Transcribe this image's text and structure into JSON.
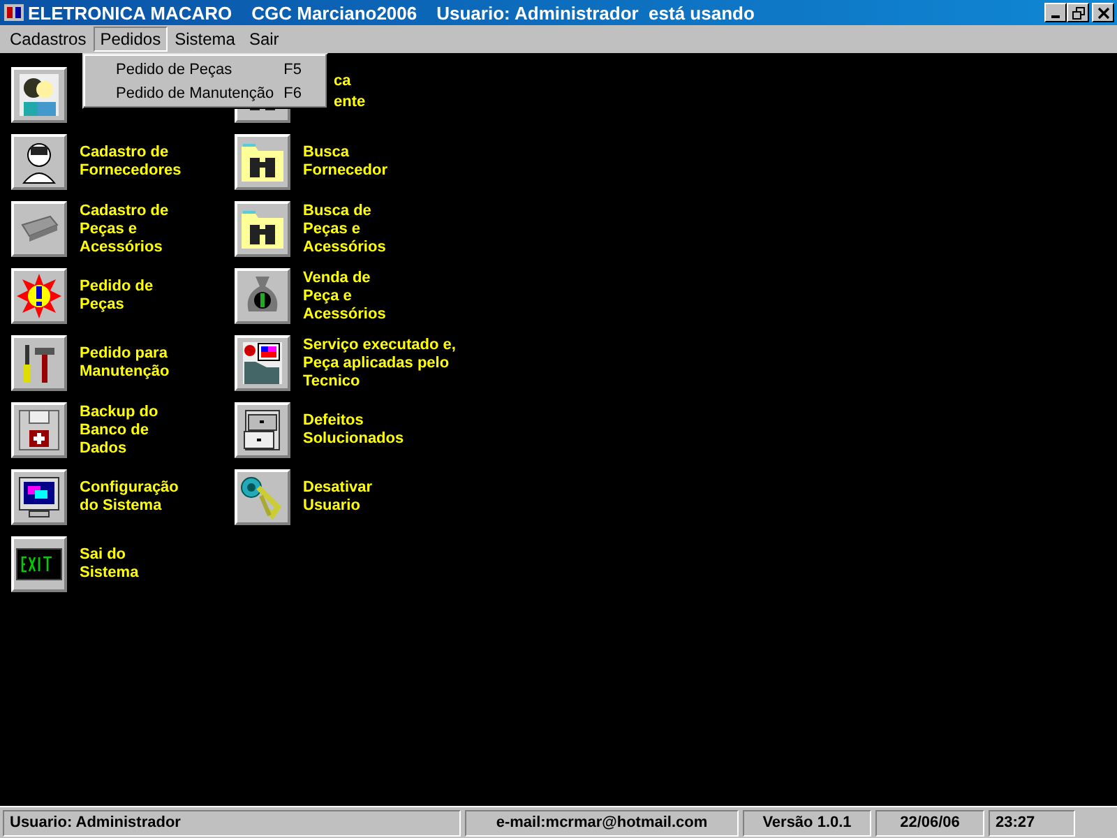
{
  "window": {
    "title_parts": [
      "ELETRONICA MACARO",
      "CGC Marciano2006",
      "Usuario: Administrador  está usando"
    ]
  },
  "menu": [
    {
      "label": "Cadastros",
      "selected": false
    },
    {
      "label": "Pedidos",
      "selected": true
    },
    {
      "label": "Sistema",
      "selected": false
    },
    {
      "label": "Sair",
      "selected": false
    }
  ],
  "dropdown": [
    {
      "label": "Pedido de Peças",
      "shortcut": "F5"
    },
    {
      "label": "Pedido de Manutenção",
      "shortcut": "F6"
    }
  ],
  "left_items": [
    {
      "lines": [
        "Cadastro de",
        "Fornecedores"
      ]
    },
    {
      "lines": [
        "Cadastro de",
        "Peças e",
        "Acessórios"
      ]
    },
    {
      "lines": [
        "Pedido de",
        "Peças"
      ]
    },
    {
      "lines": [
        "Pedido para",
        "Manutenção"
      ]
    },
    {
      "lines": [
        "Backup do",
        "Banco de",
        "Dados"
      ]
    },
    {
      "lines": [
        "Configuração",
        "do Sistema"
      ]
    },
    {
      "lines": [
        "Sai do",
        "Sistema"
      ]
    }
  ],
  "right_items": [
    {
      "lines": [
        "ca",
        "ente"
      ]
    },
    {
      "lines": [
        "Busca",
        "Fornecedor"
      ]
    },
    {
      "lines": [
        "Busca de",
        "Peças e",
        "Acessórios"
      ]
    },
    {
      "lines": [
        "Venda de",
        "Peça e",
        "Acessórios"
      ]
    },
    {
      "lines": [
        "Serviço executado e,",
        "Peça aplicadas pelo",
        "Tecnico"
      ]
    },
    {
      "lines": [
        "Defeitos",
        "Solucionados"
      ]
    },
    {
      "lines": [
        "Desativar",
        "Usuario"
      ]
    }
  ],
  "status_bar": [
    "Usuario: Administrador",
    "e-mail:mcrmar@hotmail.com",
    "Versão 1.0.1",
    "22/06/06",
    "23:27"
  ]
}
